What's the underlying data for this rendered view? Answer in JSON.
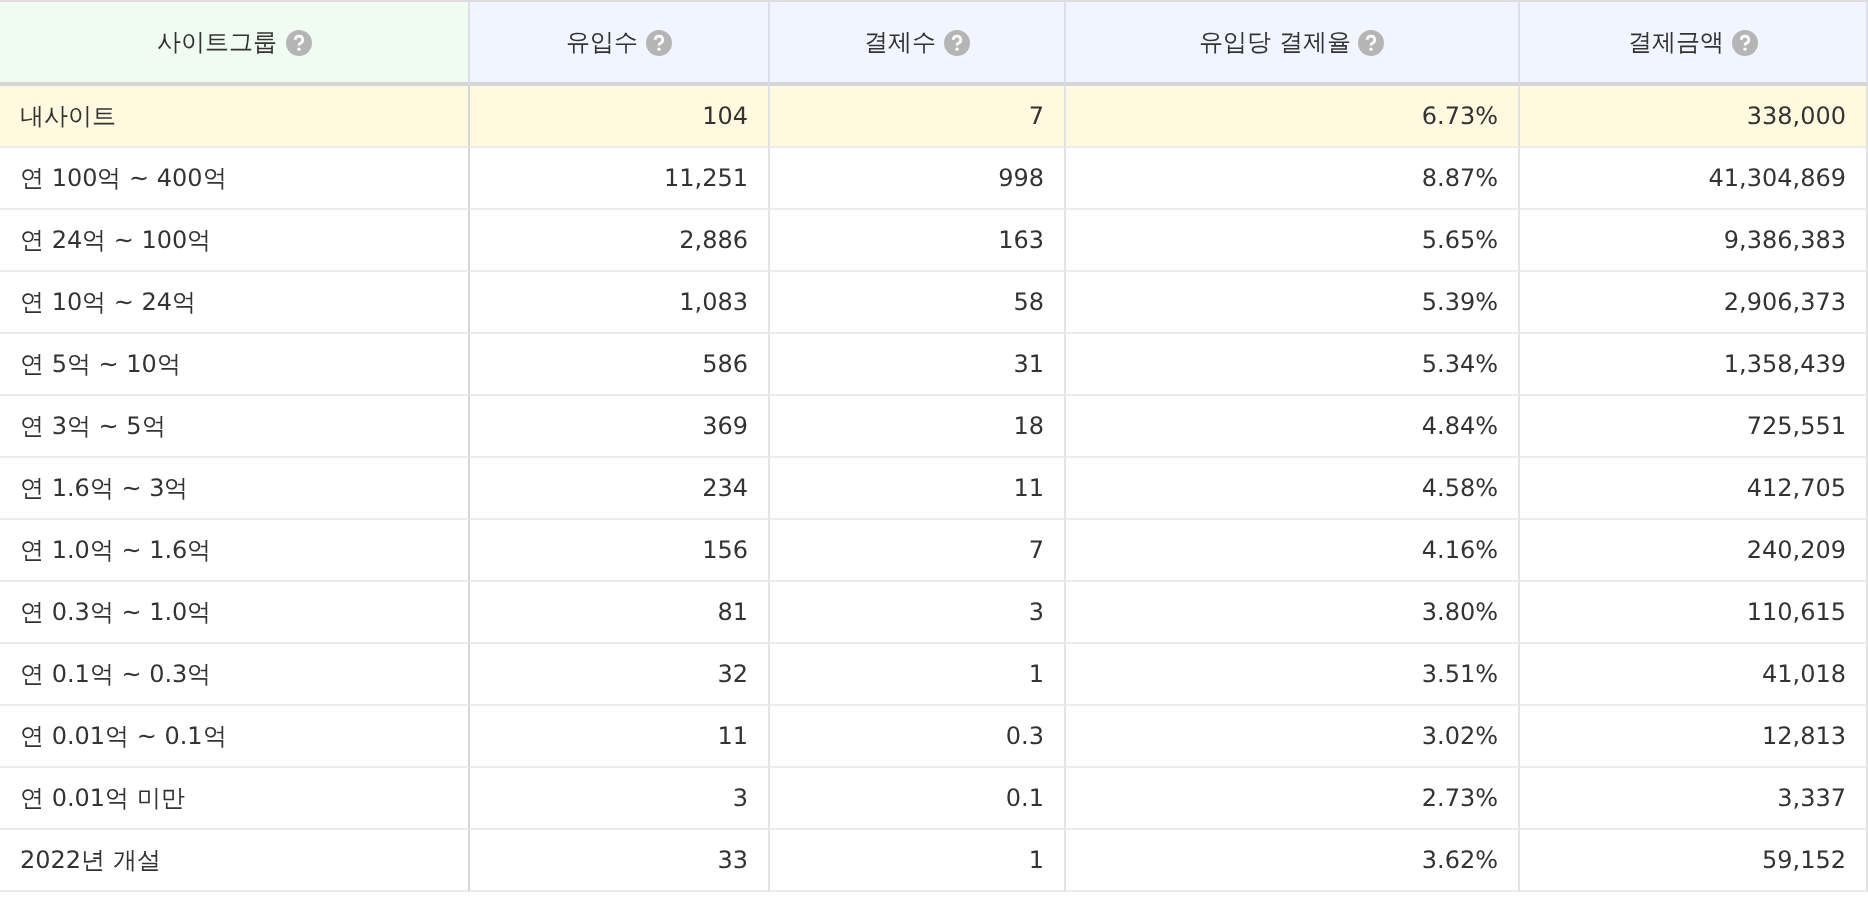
{
  "table": {
    "columns": [
      {
        "label": "사이트그룹",
        "help": true
      },
      {
        "label": "유입수",
        "help": true
      },
      {
        "label": "결제수",
        "help": true
      },
      {
        "label": "유입당 결제율",
        "help": true
      },
      {
        "label": "결제금액",
        "help": true
      }
    ],
    "rows": [
      {
        "highlighted": true,
        "cells": [
          "내사이트",
          "104",
          "7",
          "6.73%",
          "338,000"
        ]
      },
      {
        "highlighted": false,
        "cells": [
          "연 100억 ~ 400억",
          "11,251",
          "998",
          "8.87%",
          "41,304,869"
        ]
      },
      {
        "highlighted": false,
        "cells": [
          "연 24억 ~ 100억",
          "2,886",
          "163",
          "5.65%",
          "9,386,383"
        ]
      },
      {
        "highlighted": false,
        "cells": [
          "연 10억 ~ 24억",
          "1,083",
          "58",
          "5.39%",
          "2,906,373"
        ]
      },
      {
        "highlighted": false,
        "cells": [
          "연 5억 ~ 10억",
          "586",
          "31",
          "5.34%",
          "1,358,439"
        ]
      },
      {
        "highlighted": false,
        "cells": [
          "연 3억 ~ 5억",
          "369",
          "18",
          "4.84%",
          "725,551"
        ]
      },
      {
        "highlighted": false,
        "cells": [
          "연 1.6억 ~ 3억",
          "234",
          "11",
          "4.58%",
          "412,705"
        ]
      },
      {
        "highlighted": false,
        "cells": [
          "연 1.0억 ~ 1.6억",
          "156",
          "7",
          "4.16%",
          "240,209"
        ]
      },
      {
        "highlighted": false,
        "cells": [
          "연 0.3억 ~ 1.0억",
          "81",
          "3",
          "3.80%",
          "110,615"
        ]
      },
      {
        "highlighted": false,
        "cells": [
          "연 0.1억 ~ 0.3억",
          "32",
          "1",
          "3.51%",
          "41,018"
        ]
      },
      {
        "highlighted": false,
        "cells": [
          "연 0.01억 ~ 0.1억",
          "11",
          "0.3",
          "3.02%",
          "12,813"
        ]
      },
      {
        "highlighted": false,
        "cells": [
          "연 0.01억 미만",
          "3",
          "0.1",
          "2.73%",
          "3,337"
        ]
      },
      {
        "highlighted": false,
        "cells": [
          "2022년 개설",
          "33",
          "1",
          "3.62%",
          "59,152"
        ]
      }
    ]
  }
}
